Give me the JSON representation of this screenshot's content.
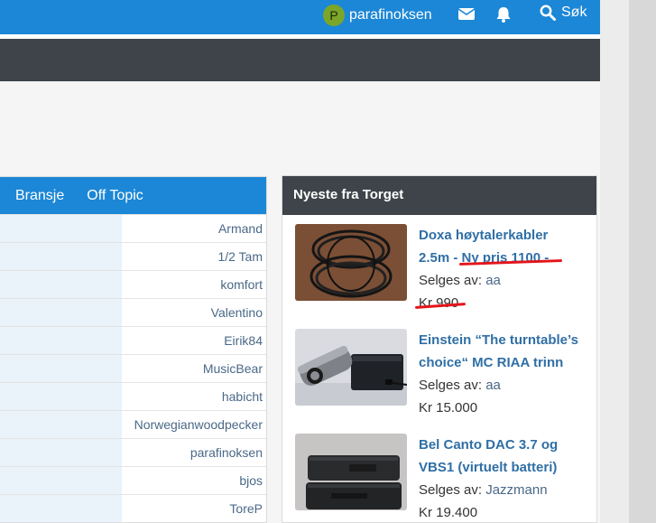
{
  "header": {
    "user": {
      "initial": "P",
      "name": "parafinoksen"
    },
    "icons": {
      "messages": "envelope-icon",
      "alerts": "bell-icon",
      "search": "search-icon"
    },
    "search_label": "Søk"
  },
  "forum": {
    "tabs": [
      "Bransje",
      "Off Topic"
    ],
    "posters": [
      "Armand",
      "1/2 Tam",
      "komfort",
      "Valentino",
      "Eirik84",
      "MusicBear",
      "habicht",
      "Norwegianwoodpecker",
      "parafinoksen",
      "bjos",
      "ToreP"
    ]
  },
  "torget": {
    "title": "Nyeste fra Torget",
    "seller_prefix": "Selges av:",
    "items": [
      {
        "title_l1": "Doxa høytalerkabler",
        "title_l2a": "2.5m",
        "title_l2b": " - Ny pris 1100 -",
        "seller": "aa",
        "price": "Kr 990"
      },
      {
        "title_l1": "Einstein “The turntable’s",
        "title_l2": "choice“ MC RIAA trinn",
        "seller": "aa",
        "price": "Kr 15.000"
      },
      {
        "title_l1": "Bel Canto DAC 3.7 og",
        "title_l2": "VBS1 (virtuelt batteri)",
        "seller": "Jazzmann",
        "price": "Kr 19.400"
      }
    ]
  },
  "colors": {
    "primary": "#1c87d6",
    "dark": "#3e4449",
    "link": "#2f6fa6",
    "annotation": "#e4141a",
    "avatar": "#7ba62a"
  }
}
